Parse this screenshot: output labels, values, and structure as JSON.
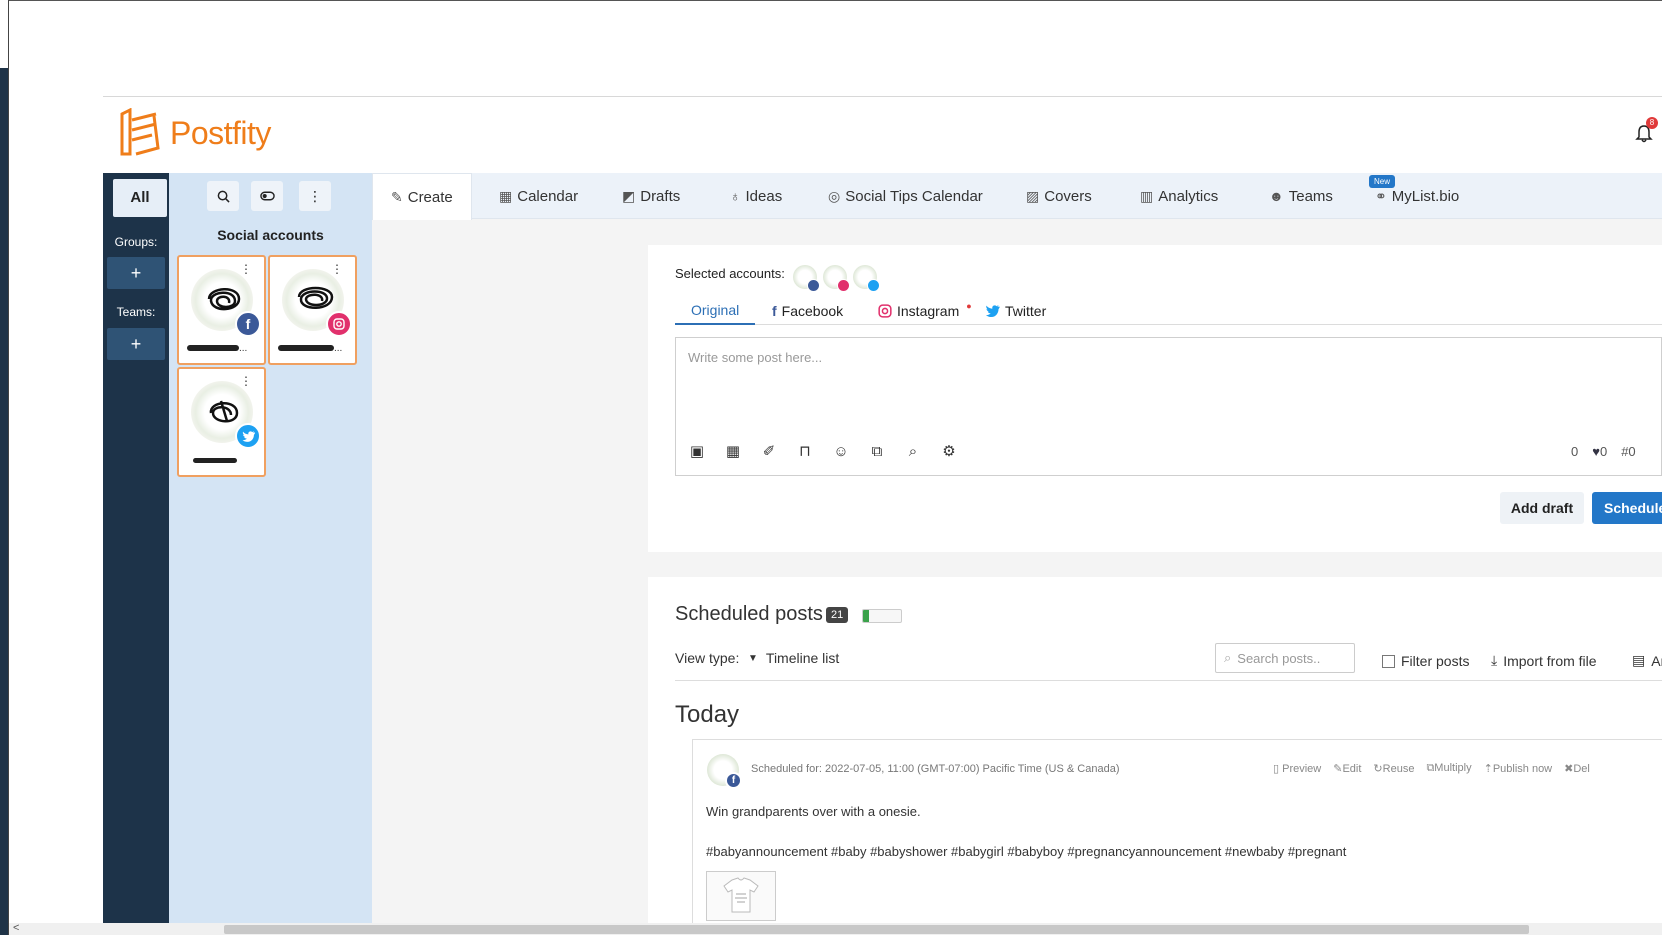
{
  "brand": {
    "name": "Postfity",
    "accent": "#ef7d1a",
    "primary": "#2377c8"
  },
  "header": {
    "notification_count": "8"
  },
  "sidebar": {
    "all_label": "All",
    "groups_label": "Groups:",
    "teams_label": "Teams:",
    "add_label": "+"
  },
  "accounts_panel": {
    "title": "Social accounts",
    "tools": [
      "search-icon",
      "toggle-icon",
      "more-icon"
    ],
    "accounts": [
      {
        "network": "facebook",
        "name_suffix": "..."
      },
      {
        "network": "instagram",
        "name_suffix": "..."
      },
      {
        "network": "twitter",
        "name_suffix": ""
      }
    ]
  },
  "tabs": [
    {
      "label": "Create",
      "icon": "edit-icon"
    },
    {
      "label": "Calendar",
      "icon": "calendar-icon"
    },
    {
      "label": "Drafts",
      "icon": "drafts-icon"
    },
    {
      "label": "Ideas",
      "icon": "bulb-icon"
    },
    {
      "label": "Social Tips Calendar",
      "icon": "compass-icon"
    },
    {
      "label": "Covers",
      "icon": "image-icon"
    },
    {
      "label": "Analytics",
      "icon": "bar-chart-icon"
    },
    {
      "label": "Teams",
      "icon": "users-icon"
    },
    {
      "label": "MyList.bio",
      "icon": "link-icon",
      "badge": "New"
    }
  ],
  "composer": {
    "selected_label": "Selected accounts:",
    "tabs": [
      "Original",
      "Facebook",
      "Instagram",
      "Twitter"
    ],
    "placeholder": "Write some post here...",
    "counts": {
      "chars": "0",
      "twitter": "0",
      "hashtags": "0"
    },
    "add_draft": "Add draft",
    "schedule": "Schedule"
  },
  "scheduled": {
    "title": "Scheduled posts",
    "count": "21",
    "progress": 0.15,
    "view_type_label": "View type:",
    "view_type_value": "Timeline list",
    "search_placeholder": "Search posts..",
    "filter_label": "Filter posts",
    "import_label": "Import from file",
    "archive_label": "Ar",
    "day_heading": "Today",
    "post": {
      "scheduled_for": "Scheduled for: 2022-07-05, 11:00 (GMT-07:00) Pacific Time (US & Canada)",
      "actions": [
        "Preview",
        "Edit",
        "Reuse",
        "Multiply",
        "Publish now",
        "Del"
      ],
      "text": "Win grandparents over with a onesie.",
      "tags": "#babyannouncement #baby #babyshower #babygirl #babyboy #pregnancyannouncement #newbaby #pregnant"
    }
  }
}
